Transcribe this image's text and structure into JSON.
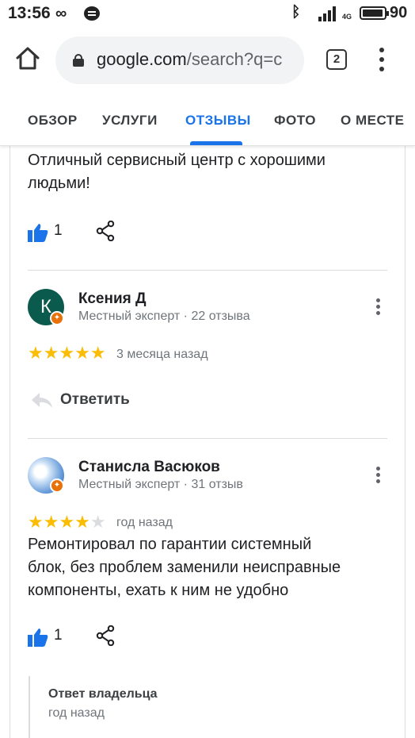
{
  "status_bar": {
    "time": "13:56",
    "battery": "90",
    "network": "4G"
  },
  "browser": {
    "url_host": "google.com",
    "url_rest": "/search?q=c",
    "tab_count": "2"
  },
  "tabs": [
    {
      "label": "ОБЗОР"
    },
    {
      "label": "УСЛУГИ"
    },
    {
      "label": "ОТЗЫВЫ"
    },
    {
      "label": "ФОТО"
    },
    {
      "label": "О МЕСТЕ"
    }
  ],
  "reviews": [
    {
      "text_lines": [
        "Отличный сервисный центр с хорошими",
        "людьми!"
      ],
      "likes": "1"
    },
    {
      "initial": "К",
      "name": "Ксения Д",
      "meta": "Местный эксперт · 22 отзыва",
      "rating": 5,
      "stars": "★★★★★",
      "when": "3 месяца назад",
      "reply_label": "Ответить"
    },
    {
      "name": "Станисла Васюков",
      "meta": "Местный эксперт · 31 отзыв",
      "rating": 4,
      "stars_on": "★★★★",
      "stars_off": "★",
      "when": "год назад",
      "text_lines": [
        "Ремонтировал по гарантии системный",
        "блок, без проблем заменили неисправные",
        "компоненты, ехать к ним не удобно"
      ],
      "likes": "1",
      "owner_reply": {
        "title": "Ответ владельца",
        "when": "год назад"
      }
    }
  ]
}
